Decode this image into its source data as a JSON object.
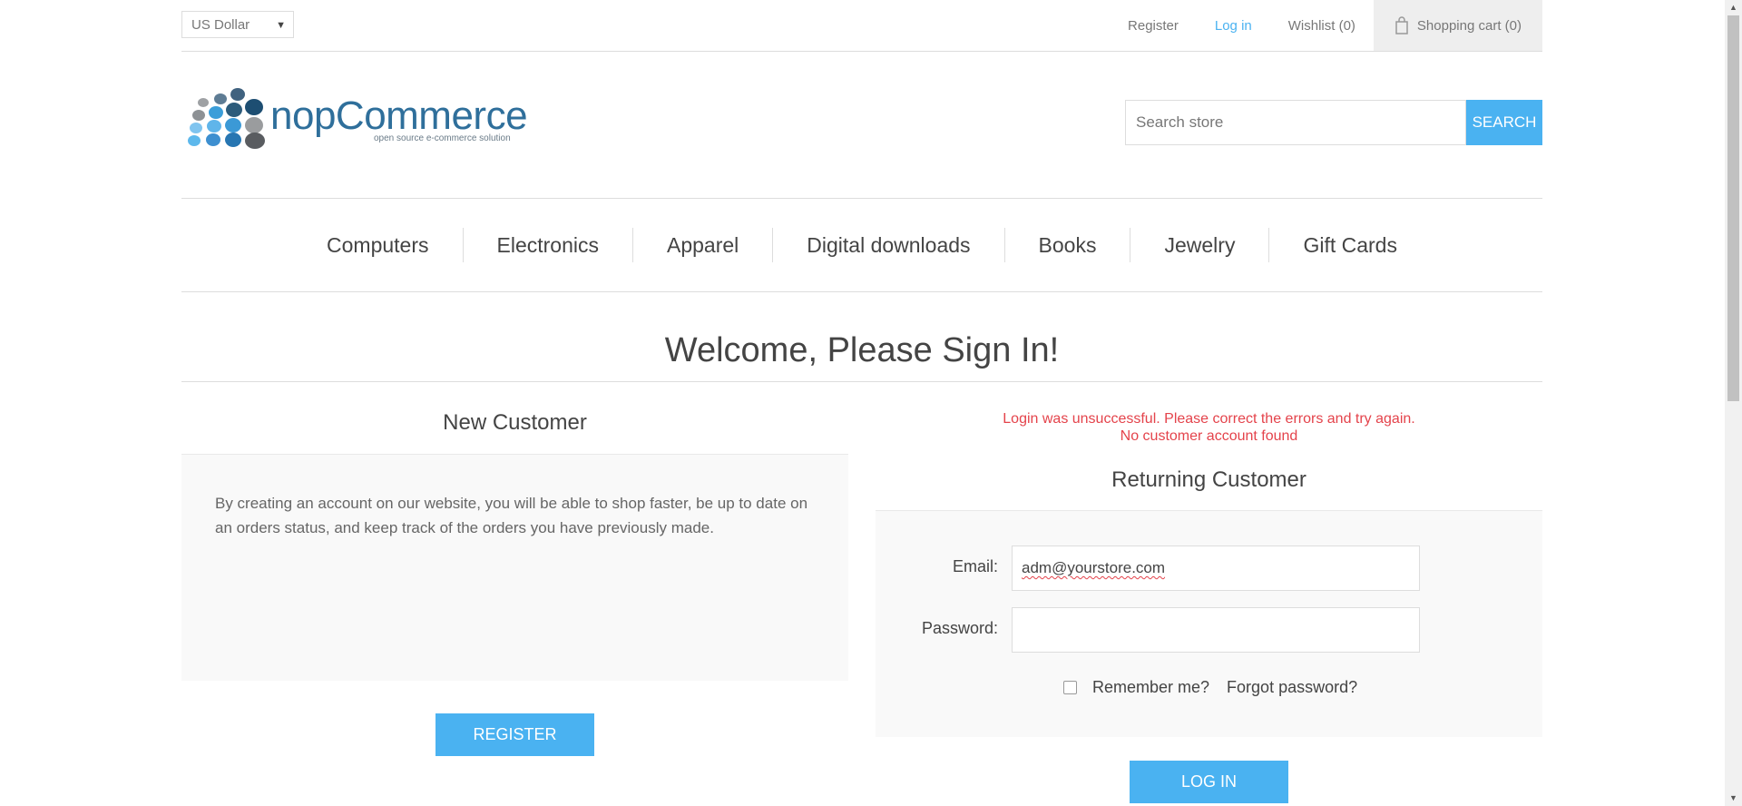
{
  "header": {
    "currency": "US Dollar",
    "links": {
      "register": "Register",
      "login": "Log in",
      "wishlist": "Wishlist (0)",
      "cart": "Shopping cart (0)"
    }
  },
  "logo": {
    "name": "nopCommerce",
    "tagline": "open source e-commerce solution"
  },
  "search": {
    "placeholder": "Search store",
    "button": "SEARCH"
  },
  "menu": [
    "Computers",
    "Electronics",
    "Apparel",
    "Digital downloads",
    "Books",
    "Jewelry",
    "Gift Cards"
  ],
  "page_title": "Welcome, Please Sign In!",
  "new_customer": {
    "title": "New Customer",
    "text": "By creating an account on our website, you will be able to shop faster, be up to date on an orders status, and keep track of the orders you have previously made.",
    "button": "REGISTER"
  },
  "returning_customer": {
    "error_line1": "Login was unsuccessful. Please correct the errors and try again.",
    "error_line2": "No customer account found",
    "title": "Returning Customer",
    "email_label": "Email:",
    "email_value": "adm@yourstore.com",
    "password_label": "Password:",
    "password_value": "",
    "remember_label": "Remember me?",
    "remember_checked": false,
    "forgot_label": "Forgot password?",
    "button": "LOG IN"
  },
  "colors": {
    "accent": "#4ab2f1",
    "error": "#e4434b",
    "panel": "#f9f9f9"
  }
}
